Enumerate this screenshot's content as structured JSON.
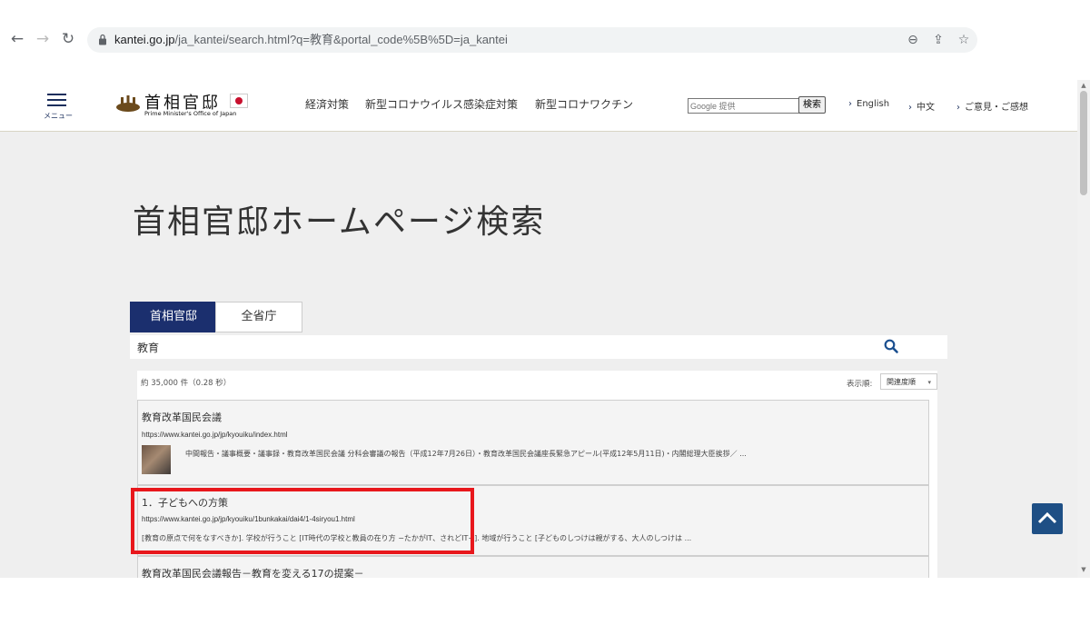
{
  "browser": {
    "url_domain": "kantei.go.jp",
    "url_path": "/ja_kantei/search.html?q=教育&portal_code%5B%5D=ja_kantei"
  },
  "header": {
    "menu_label": "メニュー",
    "logo_title": "首相官邸",
    "logo_subtitle": "Prime Minister's Office of Japan",
    "nav": [
      "経済対策",
      "新型コロナウイルス感染症対策",
      "新型コロナワクチン"
    ],
    "search_placeholder": "Google 提供",
    "search_button": "検索",
    "links": [
      "English",
      "中文",
      "ご意見・ご感想"
    ]
  },
  "main": {
    "title": "首相官邸ホームページ検索",
    "tabs": [
      "首相官邸",
      "全省庁"
    ],
    "query": "教育",
    "result_count": "約 35,000 件（0.28 秒）",
    "sort_label": "表示順:",
    "sort_value": "関連度順"
  },
  "results": [
    {
      "title": "教育改革国民会議",
      "url": "https://www.kantei.go.jp/jp/kyouiku/index.html",
      "snippet": "中間報告・議事概要・議事録・教育改革国民会議 分科会審議の報告（平成12年7月26日）・教育改革国民会議座長緊急アピール(平成12年5月11日)・内閣総理大臣挨拶／ ..."
    },
    {
      "title": "1．子どもへの方策",
      "url": "https://www.kantei.go.jp/jp/kyouiku/1bunkakai/dai4/1-4siryou1.html",
      "snippet": "[教育の原点で何をなすべきか]. 学校が行うこと [IT時代の学校と教員の在り方 −たかがIT、されどIT−]. 地域が行うこと [子どものしつけは親がする、大人のしつけは ..."
    },
    {
      "title": "教育改革国民会議報告－教育を変える17の提案－"
    }
  ]
}
